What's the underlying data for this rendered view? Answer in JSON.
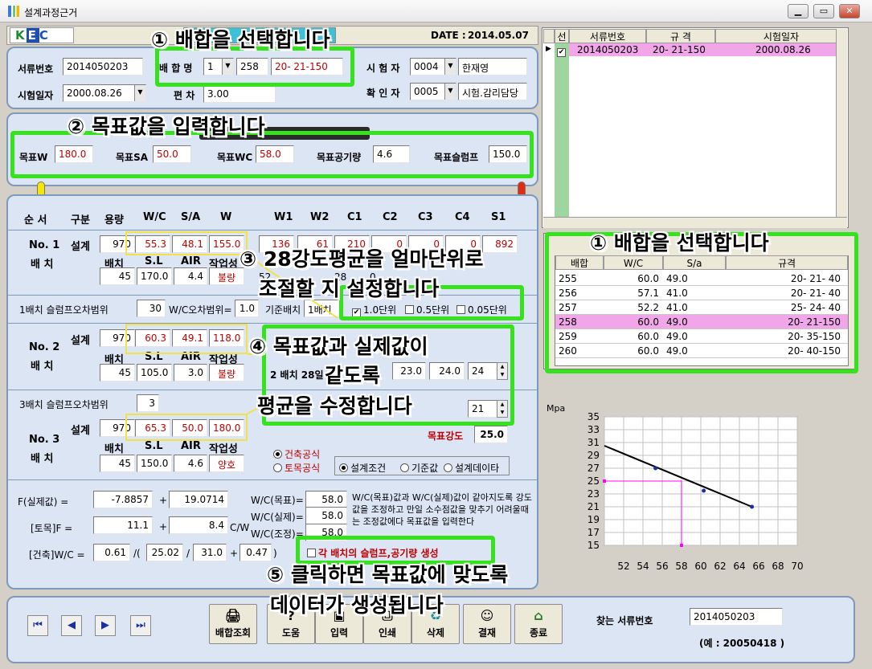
{
  "window": {
    "title": "설계과정근거",
    "min": "▁",
    "max": "▭",
    "close": "✕"
  },
  "header": {
    "logo": "KEC",
    "date_label": "DATE :",
    "date": "2014.05.07"
  },
  "info": {
    "doc_no_label": "서류번호",
    "doc_no": "2014050203",
    "mix_label": "배 합 명",
    "mix_num": "1",
    "mix_code": "258",
    "mix_spec": "20- 21-150",
    "tester_label": "시 험 자",
    "tester_code": "0004",
    "tester_name": "한재영",
    "test_date_label": "시험일자",
    "test_date": "2000.08.26",
    "dev_label": "편 차",
    "dev": "3.00",
    "checker_label": "확 인 자",
    "checker_code": "0005",
    "checker_name": "시험.감리담당"
  },
  "targets": {
    "w_label": "목표W",
    "w": "180.0",
    "sa_label": "목표SA",
    "sa": "50.0",
    "wc_label": "목표WC",
    "wc": "58.0",
    "air_label": "목표공기량",
    "air": "4.6",
    "slump_label": "목표슬럼프",
    "slump": "150.0"
  },
  "cols": [
    "순 서",
    "구분",
    "용량",
    "W/C",
    "S/A",
    "W",
    "W1",
    "W2",
    "C1",
    "C2",
    "C3",
    "C4",
    "S1"
  ],
  "batch1": {
    "no": "No. 1",
    "sub": "배 치",
    "design": "설계",
    "cap": "970",
    "wc": "55.3",
    "sa": "48.1",
    "w": "155.0",
    "w1": "136",
    "w2": "61",
    "c1": "210",
    "c2": "0",
    "c3": "0",
    "c4": "0",
    "s1": "892",
    "row2": [
      "배치",
      "S.L",
      "AIR",
      "작업성"
    ],
    "v1": "45",
    "sl": "170.0",
    "air": "4.4",
    "work": "불량",
    "hidden": "52",
    "b": "28",
    "b2": "0"
  },
  "slump1": {
    "label": "1배치 슬럼프오차범위",
    "val": "30",
    "wc_label": "W/C오차범위=",
    "wc_val": "1.0",
    "base_label": "기준배치",
    "base_val": "1배치"
  },
  "units": [
    "1.0단위",
    "0.5단위",
    "0.05단위"
  ],
  "batch2": {
    "no": "No. 2",
    "sub": "배 치",
    "design": "설계",
    "cap": "970",
    "wc": "60.3",
    "sa": "49.1",
    "w": "118.0",
    "row2": [
      "배치",
      "S.L",
      "AIR",
      "작업성"
    ],
    "v1": "45",
    "sl": "105.0",
    "air": "3.0",
    "work": "불량",
    "s28_label": "2 배치 28일",
    "s28a": "23.0",
    "s28b": "24.0",
    "s28c": "24"
  },
  "slump3": {
    "label": "3배치 슬럼프오차범위",
    "val": "3"
  },
  "batch3": {
    "no": "No. 3",
    "sub": "배 치",
    "design": "설계",
    "cap": "970",
    "wc": "65.3",
    "sa": "50.0",
    "w": "180.0",
    "row2": [
      "배치",
      "S.L",
      "AIR",
      "작업성"
    ],
    "v1": "45",
    "sl": "150.0",
    "air": "4.6",
    "work": "양호",
    "s28c": "21",
    "target_strength_label": "목표강도",
    "target_strength": "25.0"
  },
  "method": {
    "a": "건축공식",
    "b": "토목공식"
  },
  "mode": {
    "a": "설계조건",
    "b": "기준값",
    "c": "설계데이타"
  },
  "formula": {
    "f_label": "F(실제값) =",
    "f1": "-7.8857",
    "plus": "+",
    "f2": "19.0714",
    "t_label": "[토목]F =",
    "t1": "11.1",
    "t2": "8.4",
    "t_unit": "C/W",
    "k_label": "[건축]W/C =",
    "k1": "0.61",
    "k_op1": "/(",
    "k2": "25.02",
    "k_op2": "/",
    "k3": "31.0",
    "k_op3": "+",
    "k4": "0.47",
    "k_close": ")",
    "wc_target_label": "W/C(목표)=",
    "wc_target": "58.0",
    "wc_actual_label": "W/C(실제)=",
    "wc_actual": "58.0",
    "wc_adj_label": "W/C(조정)=",
    "wc_adj": "58.0",
    "note": "W/C(목표)값과 W/C(실제)값이 같아지도록 강도값을 조정하고 만일 소수점값을 맞추기 어려울때는 조정값에다 목표값을 입력한다",
    "gen_label": "각 배치의 슬럼프,공기량 생성"
  },
  "top_grid": {
    "cols": [
      "선",
      "서류번호",
      "규 격",
      "시험일자"
    ],
    "rows": [
      {
        "checked": "✔",
        "doc": "2014050203",
        "spec": "20- 21-150",
        "date": "2000.08.26"
      }
    ]
  },
  "mix_grid": {
    "cols": [
      "배합",
      "W/C",
      "S/a",
      "규격"
    ],
    "rows": [
      {
        "no": "255",
        "wc": "60.0",
        "sa": "49.0",
        "spec": "20- 21- 40"
      },
      {
        "no": "256",
        "wc": "57.1",
        "sa": "41.0",
        "spec": "20- 21- 40"
      },
      {
        "no": "257",
        "wc": "52.2",
        "sa": "41.0",
        "spec": "25- 24- 40"
      },
      {
        "no": "258",
        "wc": "60.0",
        "sa": "49.0",
        "spec": "20- 21-150"
      },
      {
        "no": "259",
        "wc": "60.0",
        "sa": "49.0",
        "spec": "20- 35-150"
      },
      {
        "no": "260",
        "wc": "60.0",
        "sa": "49.0",
        "spec": "20- 40-150"
      }
    ]
  },
  "chart_data": {
    "type": "scatter",
    "ylabel": "Mpa",
    "x_ticks": [
      "52",
      "54",
      "56",
      "58",
      "60",
      "62",
      "64",
      "66",
      "68",
      "70"
    ],
    "y_ticks": [
      "35",
      "33",
      "31",
      "29",
      "27",
      "25",
      "23",
      "21",
      "19",
      "17",
      "15"
    ],
    "xlim": [
      50,
      70
    ],
    "ylim": [
      15,
      35
    ],
    "points": [
      {
        "x": 55.3,
        "y": 27.0
      },
      {
        "x": 60.3,
        "y": 23.5
      },
      {
        "x": 65.3,
        "y": 21.0
      }
    ],
    "line": [
      {
        "x": 50,
        "y": 30.5
      },
      {
        "x": 65.3,
        "y": 21.0
      }
    ],
    "target_point": {
      "x": 58.0,
      "y": 25.0
    },
    "colors": {
      "line": "#000000",
      "marker": "#1a2fa0",
      "guide": "#ff00ff"
    }
  },
  "nav": {
    "first": "⏮",
    "prev": "◀",
    "next": "▶",
    "last": "⏭"
  },
  "buttons": [
    "배합조회",
    "도움",
    "입력",
    "인쇄",
    "삭제",
    "결재",
    "종료"
  ],
  "search": {
    "label": "찾는 서류번호",
    "value": "2014050203",
    "example": "(예 : 20050418 )"
  },
  "annotations": {
    "a1": "① 배합을 선택합니다",
    "a2": "② 목표값을 입력합니다",
    "a3a": "③ 28강도평균을 얼마단위로",
    "a3b": "조절할 지 설정합니다",
    "a4a": "④ 목표값과 실제값이",
    "a4b": "같도록",
    "a4c": "평균을 수정합니다",
    "a1b": "① 배합을 선택합니다",
    "a5a": "⑤ 클릭하면 목표값에 맞도록",
    "a5b": "데이터가 생성됩니다"
  }
}
